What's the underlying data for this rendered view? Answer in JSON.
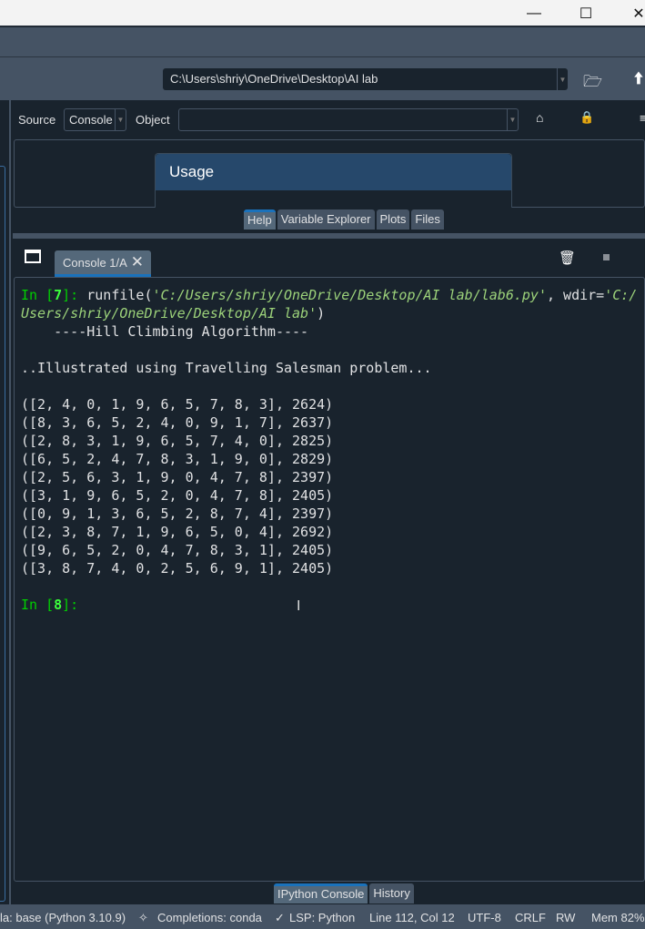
{
  "window": {
    "controls": [
      "minimize",
      "maximize",
      "close"
    ]
  },
  "toolbar": {
    "path": "C:\\Users\\shriy\\OneDrive\\Desktop\\AI lab",
    "icons": [
      "folder-open-icon",
      "arrow-up-icon"
    ]
  },
  "help": {
    "source_label": "Source",
    "source_value": "Console",
    "object_label": "Object",
    "object_value": "",
    "usage_title": "Usage",
    "tabs": [
      {
        "label": "Help",
        "selected": true
      },
      {
        "label": "Variable Explorer"
      },
      {
        "label": "Plots"
      },
      {
        "label": "Files"
      }
    ]
  },
  "console": {
    "tab_label": "Console 1/A",
    "prompt1": "In [",
    "prompt1_num": "7",
    "prompt1_end": "]: ",
    "cmd_start": "runfile(",
    "cmd_arg1": "'C:/Users/shriy/OneDrive/Desktop/AI lab/lab6.py'",
    "cmd_mid": ", wdir=",
    "cmd_arg2a": "'C:/",
    "cmd_arg2b": "Users/shriy/OneDrive/Desktop/AI lab'",
    "cmd_end": ")",
    "lines": [
      "    ----Hill Climbing Algorithm----",
      "",
      "..Illustrated using Travelling Salesman problem...",
      "",
      "([2, 4, 0, 1, 9, 6, 5, 7, 8, 3], 2624)",
      "([8, 3, 6, 5, 2, 4, 0, 9, 1, 7], 2637)",
      "([2, 8, 3, 1, 9, 6, 5, 7, 4, 0], 2825)",
      "([6, 5, 2, 4, 7, 8, 3, 1, 9, 0], 2829)",
      "([2, 5, 6, 3, 1, 9, 0, 4, 7, 8], 2397)",
      "([3, 1, 9, 6, 5, 2, 0, 4, 7, 8], 2405)",
      "([0, 9, 1, 3, 6, 5, 2, 8, 7, 4], 2397)",
      "([2, 3, 8, 7, 1, 9, 6, 5, 0, 4], 2692)",
      "([9, 6, 5, 2, 0, 4, 7, 8, 3, 1], 2405)",
      "([3, 8, 7, 4, 0, 2, 5, 6, 9, 1], 2405)",
      ""
    ],
    "prompt2": "In [",
    "prompt2_num": "8",
    "prompt2_end": "]:",
    "tabs": [
      {
        "label": "IPython Console",
        "selected": true
      },
      {
        "label": "History"
      }
    ]
  },
  "status": {
    "env": "la: base (Python 3.10.9)",
    "completions": "Completions: conda",
    "lsp": "LSP: Python",
    "position": "Line 112, Col 12",
    "encoding": "UTF-8",
    "eol": "CRLF",
    "mode": "RW",
    "mem": "Mem 82%"
  }
}
